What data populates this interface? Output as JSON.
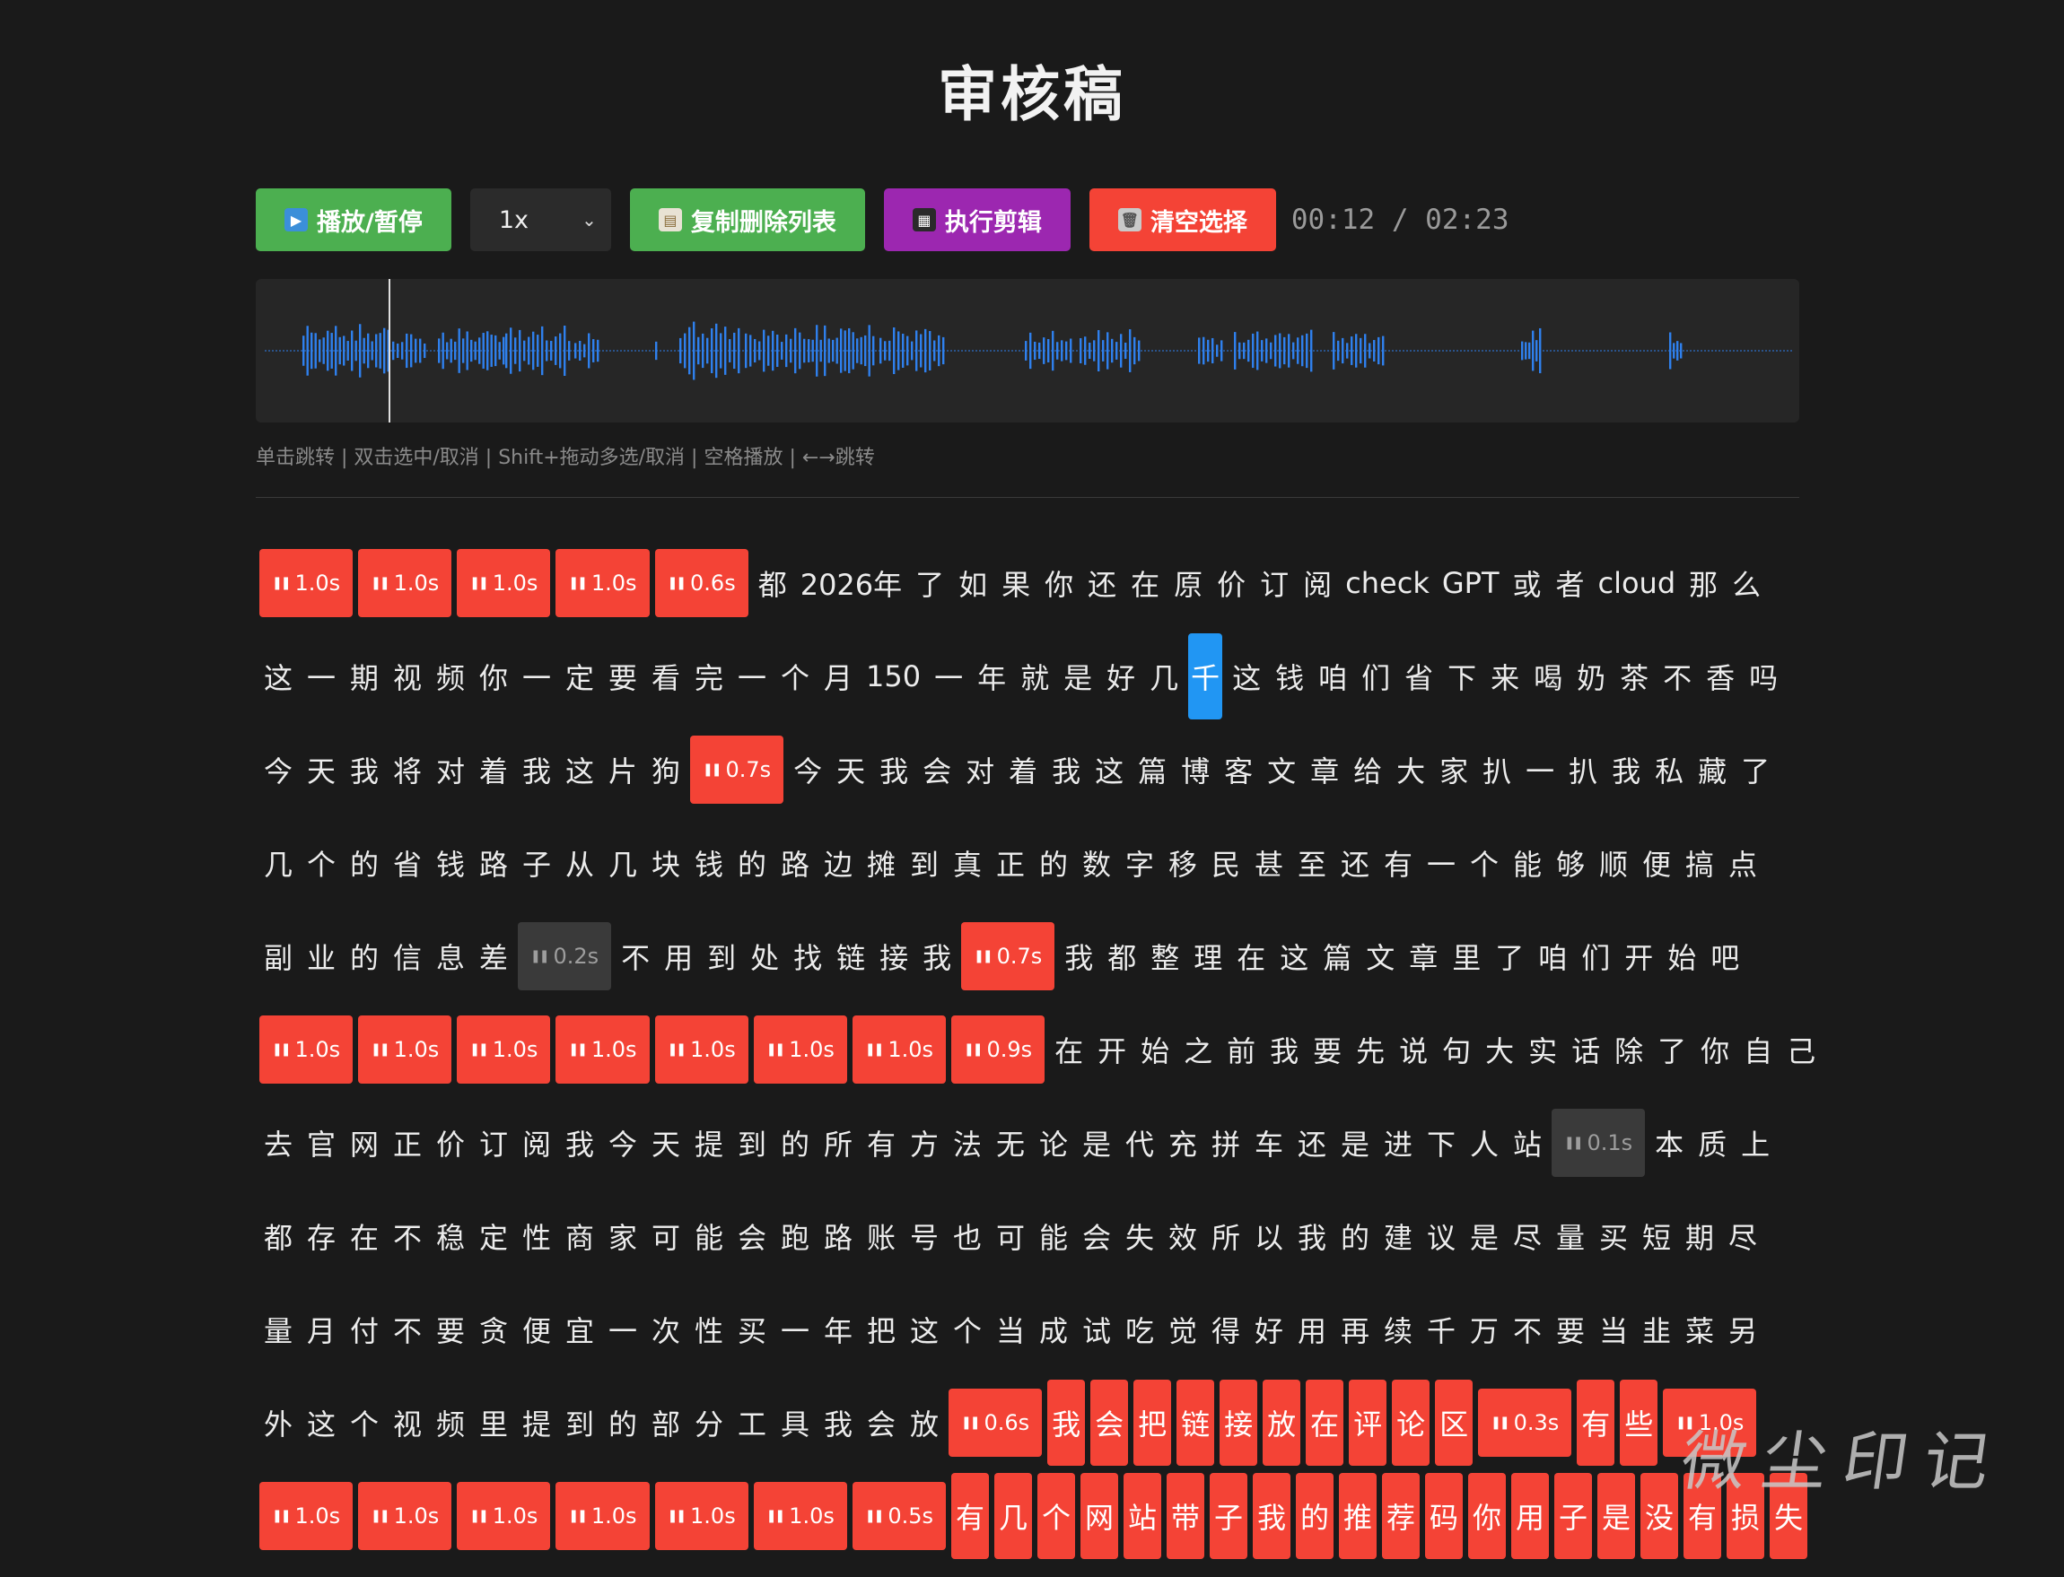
{
  "title": "审核稿",
  "toolbar": {
    "play_label": "播放/暂停",
    "speed_value": "1x",
    "copy_label": "复制删除列表",
    "execute_label": "执行剪辑",
    "clear_label": "清空选择",
    "time": "00:12 / 02:23"
  },
  "hint": "单击跳转 | 双击选中/取消 | Shift+拖动多选/取消 | 空格播放 | ←→跳转",
  "watermark": "微尘印记",
  "colors": {
    "play": "#4caf50",
    "execute": "#9c27b0",
    "delete": "#f44336",
    "selected": "#2196f3",
    "wave": "#2f80ed"
  },
  "playhead_time": "00:12",
  "lines": [
    [
      {
        "t": "pause",
        "d": "1.0s"
      },
      {
        "t": "pause",
        "d": "1.0s"
      },
      {
        "t": "pause",
        "d": "1.0s"
      },
      {
        "t": "pause",
        "d": "1.0s"
      },
      {
        "t": "pause",
        "d": "0.6s"
      },
      {
        "t": "ch",
        "v": "都"
      },
      {
        "t": "ch",
        "v": "2026年"
      },
      {
        "t": "ch",
        "v": "了"
      },
      {
        "t": "ch",
        "v": "如"
      },
      {
        "t": "ch",
        "v": "果"
      },
      {
        "t": "ch",
        "v": "你"
      },
      {
        "t": "ch",
        "v": "还"
      },
      {
        "t": "ch",
        "v": "在"
      },
      {
        "t": "ch",
        "v": "原"
      },
      {
        "t": "ch",
        "v": "价"
      },
      {
        "t": "ch",
        "v": "订"
      },
      {
        "t": "ch",
        "v": "阅"
      },
      {
        "t": "ch",
        "v": "check"
      },
      {
        "t": "ch",
        "v": "GPT"
      },
      {
        "t": "ch",
        "v": "或"
      },
      {
        "t": "ch",
        "v": "者"
      },
      {
        "t": "ch",
        "v": "cloud"
      },
      {
        "t": "ch",
        "v": "那"
      },
      {
        "t": "ch",
        "v": "么"
      }
    ],
    [
      {
        "t": "ch",
        "v": "这"
      },
      {
        "t": "ch",
        "v": "一"
      },
      {
        "t": "ch",
        "v": "期"
      },
      {
        "t": "ch",
        "v": "视"
      },
      {
        "t": "ch",
        "v": "频"
      },
      {
        "t": "ch",
        "v": "你"
      },
      {
        "t": "ch",
        "v": "一"
      },
      {
        "t": "ch",
        "v": "定"
      },
      {
        "t": "ch",
        "v": "要"
      },
      {
        "t": "ch",
        "v": "看"
      },
      {
        "t": "ch",
        "v": "完"
      },
      {
        "t": "ch",
        "v": "一"
      },
      {
        "t": "ch",
        "v": "个"
      },
      {
        "t": "ch",
        "v": "月"
      },
      {
        "t": "ch",
        "v": "150"
      },
      {
        "t": "ch",
        "v": "一"
      },
      {
        "t": "ch",
        "v": "年"
      },
      {
        "t": "ch",
        "v": "就"
      },
      {
        "t": "ch",
        "v": "是"
      },
      {
        "t": "ch",
        "v": "好"
      },
      {
        "t": "ch",
        "v": "几"
      },
      {
        "t": "sel",
        "v": "千"
      },
      {
        "t": "ch",
        "v": "这"
      },
      {
        "t": "ch",
        "v": "钱"
      },
      {
        "t": "ch",
        "v": "咱"
      },
      {
        "t": "ch",
        "v": "们"
      },
      {
        "t": "ch",
        "v": "省"
      },
      {
        "t": "ch",
        "v": "下"
      },
      {
        "t": "ch",
        "v": "来"
      },
      {
        "t": "ch",
        "v": "喝"
      },
      {
        "t": "ch",
        "v": "奶"
      },
      {
        "t": "ch",
        "v": "茶"
      },
      {
        "t": "ch",
        "v": "不"
      },
      {
        "t": "ch",
        "v": "香"
      },
      {
        "t": "ch",
        "v": "吗"
      }
    ],
    [
      {
        "t": "ch",
        "v": "今"
      },
      {
        "t": "ch",
        "v": "天"
      },
      {
        "t": "ch",
        "v": "我"
      },
      {
        "t": "ch",
        "v": "将"
      },
      {
        "t": "ch",
        "v": "对"
      },
      {
        "t": "ch",
        "v": "着"
      },
      {
        "t": "ch",
        "v": "我"
      },
      {
        "t": "ch",
        "v": "这"
      },
      {
        "t": "ch",
        "v": "片"
      },
      {
        "t": "ch",
        "v": "狗"
      },
      {
        "t": "pause",
        "d": "0.7s"
      },
      {
        "t": "ch",
        "v": "今"
      },
      {
        "t": "ch",
        "v": "天"
      },
      {
        "t": "ch",
        "v": "我"
      },
      {
        "t": "ch",
        "v": "会"
      },
      {
        "t": "ch",
        "v": "对"
      },
      {
        "t": "ch",
        "v": "着"
      },
      {
        "t": "ch",
        "v": "我"
      },
      {
        "t": "ch",
        "v": "这"
      },
      {
        "t": "ch",
        "v": "篇"
      },
      {
        "t": "ch",
        "v": "博"
      },
      {
        "t": "ch",
        "v": "客"
      },
      {
        "t": "ch",
        "v": "文"
      },
      {
        "t": "ch",
        "v": "章"
      },
      {
        "t": "ch",
        "v": "给"
      },
      {
        "t": "ch",
        "v": "大"
      },
      {
        "t": "ch",
        "v": "家"
      },
      {
        "t": "ch",
        "v": "扒"
      },
      {
        "t": "ch",
        "v": "一"
      },
      {
        "t": "ch",
        "v": "扒"
      },
      {
        "t": "ch",
        "v": "我"
      },
      {
        "t": "ch",
        "v": "私"
      },
      {
        "t": "ch",
        "v": "藏"
      },
      {
        "t": "ch",
        "v": "了"
      }
    ],
    [
      {
        "t": "ch",
        "v": "几"
      },
      {
        "t": "ch",
        "v": "个"
      },
      {
        "t": "ch",
        "v": "的"
      },
      {
        "t": "ch",
        "v": "省"
      },
      {
        "t": "ch",
        "v": "钱"
      },
      {
        "t": "ch",
        "v": "路"
      },
      {
        "t": "ch",
        "v": "子"
      },
      {
        "t": "ch",
        "v": "从"
      },
      {
        "t": "ch",
        "v": "几"
      },
      {
        "t": "ch",
        "v": "块"
      },
      {
        "t": "ch",
        "v": "钱"
      },
      {
        "t": "ch",
        "v": "的"
      },
      {
        "t": "ch",
        "v": "路"
      },
      {
        "t": "ch",
        "v": "边"
      },
      {
        "t": "ch",
        "v": "摊"
      },
      {
        "t": "ch",
        "v": "到"
      },
      {
        "t": "ch",
        "v": "真"
      },
      {
        "t": "ch",
        "v": "正"
      },
      {
        "t": "ch",
        "v": "的"
      },
      {
        "t": "ch",
        "v": "数"
      },
      {
        "t": "ch",
        "v": "字"
      },
      {
        "t": "ch",
        "v": "移"
      },
      {
        "t": "ch",
        "v": "民"
      },
      {
        "t": "ch",
        "v": "甚"
      },
      {
        "t": "ch",
        "v": "至"
      },
      {
        "t": "ch",
        "v": "还"
      },
      {
        "t": "ch",
        "v": "有"
      },
      {
        "t": "ch",
        "v": "一"
      },
      {
        "t": "ch",
        "v": "个"
      },
      {
        "t": "ch",
        "v": "能"
      },
      {
        "t": "ch",
        "v": "够"
      },
      {
        "t": "ch",
        "v": "顺"
      },
      {
        "t": "ch",
        "v": "便"
      },
      {
        "t": "ch",
        "v": "搞"
      },
      {
        "t": "ch",
        "v": "点"
      }
    ],
    [
      {
        "t": "ch",
        "v": "副"
      },
      {
        "t": "ch",
        "v": "业"
      },
      {
        "t": "ch",
        "v": "的"
      },
      {
        "t": "ch",
        "v": "信"
      },
      {
        "t": "ch",
        "v": "息"
      },
      {
        "t": "ch",
        "v": "差"
      },
      {
        "t": "gpause",
        "d": "0.2s"
      },
      {
        "t": "ch",
        "v": "不"
      },
      {
        "t": "ch",
        "v": "用"
      },
      {
        "t": "ch",
        "v": "到"
      },
      {
        "t": "ch",
        "v": "处"
      },
      {
        "t": "ch",
        "v": "找"
      },
      {
        "t": "ch",
        "v": "链"
      },
      {
        "t": "ch",
        "v": "接"
      },
      {
        "t": "ch",
        "v": "我"
      },
      {
        "t": "pause",
        "d": "0.7s"
      },
      {
        "t": "ch",
        "v": "我"
      },
      {
        "t": "ch",
        "v": "都"
      },
      {
        "t": "ch",
        "v": "整"
      },
      {
        "t": "ch",
        "v": "理"
      },
      {
        "t": "ch",
        "v": "在"
      },
      {
        "t": "ch",
        "v": "这"
      },
      {
        "t": "ch",
        "v": "篇"
      },
      {
        "t": "ch",
        "v": "文"
      },
      {
        "t": "ch",
        "v": "章"
      },
      {
        "t": "ch",
        "v": "里"
      },
      {
        "t": "ch",
        "v": "了"
      },
      {
        "t": "ch",
        "v": "咱"
      },
      {
        "t": "ch",
        "v": "们"
      },
      {
        "t": "ch",
        "v": "开"
      },
      {
        "t": "ch",
        "v": "始"
      },
      {
        "t": "ch",
        "v": "吧"
      }
    ],
    [
      {
        "t": "pause",
        "d": "1.0s"
      },
      {
        "t": "pause",
        "d": "1.0s"
      },
      {
        "t": "pause",
        "d": "1.0s"
      },
      {
        "t": "pause",
        "d": "1.0s"
      },
      {
        "t": "pause",
        "d": "1.0s"
      },
      {
        "t": "pause",
        "d": "1.0s"
      },
      {
        "t": "pause",
        "d": "1.0s"
      },
      {
        "t": "pause",
        "d": "0.9s"
      },
      {
        "t": "ch",
        "v": "在"
      },
      {
        "t": "ch",
        "v": "开"
      },
      {
        "t": "ch",
        "v": "始"
      },
      {
        "t": "ch",
        "v": "之"
      },
      {
        "t": "ch",
        "v": "前"
      },
      {
        "t": "ch",
        "v": "我"
      },
      {
        "t": "ch",
        "v": "要"
      },
      {
        "t": "ch",
        "v": "先"
      },
      {
        "t": "ch",
        "v": "说"
      },
      {
        "t": "ch",
        "v": "句"
      },
      {
        "t": "ch",
        "v": "大"
      },
      {
        "t": "ch",
        "v": "实"
      },
      {
        "t": "ch",
        "v": "话"
      },
      {
        "t": "ch",
        "v": "除"
      },
      {
        "t": "ch",
        "v": "了"
      },
      {
        "t": "ch",
        "v": "你"
      },
      {
        "t": "ch",
        "v": "自"
      },
      {
        "t": "ch",
        "v": "己"
      }
    ],
    [
      {
        "t": "ch",
        "v": "去"
      },
      {
        "t": "ch",
        "v": "官"
      },
      {
        "t": "ch",
        "v": "网"
      },
      {
        "t": "ch",
        "v": "正"
      },
      {
        "t": "ch",
        "v": "价"
      },
      {
        "t": "ch",
        "v": "订"
      },
      {
        "t": "ch",
        "v": "阅"
      },
      {
        "t": "ch",
        "v": "我"
      },
      {
        "t": "ch",
        "v": "今"
      },
      {
        "t": "ch",
        "v": "天"
      },
      {
        "t": "ch",
        "v": "提"
      },
      {
        "t": "ch",
        "v": "到"
      },
      {
        "t": "ch",
        "v": "的"
      },
      {
        "t": "ch",
        "v": "所"
      },
      {
        "t": "ch",
        "v": "有"
      },
      {
        "t": "ch",
        "v": "方"
      },
      {
        "t": "ch",
        "v": "法"
      },
      {
        "t": "ch",
        "v": "无"
      },
      {
        "t": "ch",
        "v": "论"
      },
      {
        "t": "ch",
        "v": "是"
      },
      {
        "t": "ch",
        "v": "代"
      },
      {
        "t": "ch",
        "v": "充"
      },
      {
        "t": "ch",
        "v": "拼"
      },
      {
        "t": "ch",
        "v": "车"
      },
      {
        "t": "ch",
        "v": "还"
      },
      {
        "t": "ch",
        "v": "是"
      },
      {
        "t": "ch",
        "v": "进"
      },
      {
        "t": "ch",
        "v": "下"
      },
      {
        "t": "ch",
        "v": "人"
      },
      {
        "t": "ch",
        "v": "站"
      },
      {
        "t": "gpause",
        "d": "0.1s"
      },
      {
        "t": "ch",
        "v": "本"
      },
      {
        "t": "ch",
        "v": "质"
      },
      {
        "t": "ch",
        "v": "上"
      }
    ],
    [
      {
        "t": "ch",
        "v": "都"
      },
      {
        "t": "ch",
        "v": "存"
      },
      {
        "t": "ch",
        "v": "在"
      },
      {
        "t": "ch",
        "v": "不"
      },
      {
        "t": "ch",
        "v": "稳"
      },
      {
        "t": "ch",
        "v": "定"
      },
      {
        "t": "ch",
        "v": "性"
      },
      {
        "t": "ch",
        "v": "商"
      },
      {
        "t": "ch",
        "v": "家"
      },
      {
        "t": "ch",
        "v": "可"
      },
      {
        "t": "ch",
        "v": "能"
      },
      {
        "t": "ch",
        "v": "会"
      },
      {
        "t": "ch",
        "v": "跑"
      },
      {
        "t": "ch",
        "v": "路"
      },
      {
        "t": "ch",
        "v": "账"
      },
      {
        "t": "ch",
        "v": "号"
      },
      {
        "t": "ch",
        "v": "也"
      },
      {
        "t": "ch",
        "v": "可"
      },
      {
        "t": "ch",
        "v": "能"
      },
      {
        "t": "ch",
        "v": "会"
      },
      {
        "t": "ch",
        "v": "失"
      },
      {
        "t": "ch",
        "v": "效"
      },
      {
        "t": "ch",
        "v": "所"
      },
      {
        "t": "ch",
        "v": "以"
      },
      {
        "t": "ch",
        "v": "我"
      },
      {
        "t": "ch",
        "v": "的"
      },
      {
        "t": "ch",
        "v": "建"
      },
      {
        "t": "ch",
        "v": "议"
      },
      {
        "t": "ch",
        "v": "是"
      },
      {
        "t": "ch",
        "v": "尽"
      },
      {
        "t": "ch",
        "v": "量"
      },
      {
        "t": "ch",
        "v": "买"
      },
      {
        "t": "ch",
        "v": "短"
      },
      {
        "t": "ch",
        "v": "期"
      },
      {
        "t": "ch",
        "v": "尽"
      }
    ],
    [
      {
        "t": "ch",
        "v": "量"
      },
      {
        "t": "ch",
        "v": "月"
      },
      {
        "t": "ch",
        "v": "付"
      },
      {
        "t": "ch",
        "v": "不"
      },
      {
        "t": "ch",
        "v": "要"
      },
      {
        "t": "ch",
        "v": "贪"
      },
      {
        "t": "ch",
        "v": "便"
      },
      {
        "t": "ch",
        "v": "宜"
      },
      {
        "t": "ch",
        "v": "一"
      },
      {
        "t": "ch",
        "v": "次"
      },
      {
        "t": "ch",
        "v": "性"
      },
      {
        "t": "ch",
        "v": "买"
      },
      {
        "t": "ch",
        "v": "一"
      },
      {
        "t": "ch",
        "v": "年"
      },
      {
        "t": "ch",
        "v": "把"
      },
      {
        "t": "ch",
        "v": "这"
      },
      {
        "t": "ch",
        "v": "个"
      },
      {
        "t": "ch",
        "v": "当"
      },
      {
        "t": "ch",
        "v": "成"
      },
      {
        "t": "ch",
        "v": "试"
      },
      {
        "t": "ch",
        "v": "吃"
      },
      {
        "t": "ch",
        "v": "觉"
      },
      {
        "t": "ch",
        "v": "得"
      },
      {
        "t": "ch",
        "v": "好"
      },
      {
        "t": "ch",
        "v": "用"
      },
      {
        "t": "ch",
        "v": "再"
      },
      {
        "t": "ch",
        "v": "续"
      },
      {
        "t": "ch",
        "v": "千"
      },
      {
        "t": "ch",
        "v": "万"
      },
      {
        "t": "ch",
        "v": "不"
      },
      {
        "t": "ch",
        "v": "要"
      },
      {
        "t": "ch",
        "v": "当"
      },
      {
        "t": "ch",
        "v": "韭"
      },
      {
        "t": "ch",
        "v": "菜"
      },
      {
        "t": "ch",
        "v": "另"
      }
    ],
    [
      {
        "t": "ch",
        "v": "外"
      },
      {
        "t": "ch",
        "v": "这"
      },
      {
        "t": "ch",
        "v": "个"
      },
      {
        "t": "ch",
        "v": "视"
      },
      {
        "t": "ch",
        "v": "频"
      },
      {
        "t": "ch",
        "v": "里"
      },
      {
        "t": "ch",
        "v": "提"
      },
      {
        "t": "ch",
        "v": "到"
      },
      {
        "t": "ch",
        "v": "的"
      },
      {
        "t": "ch",
        "v": "部"
      },
      {
        "t": "ch",
        "v": "分"
      },
      {
        "t": "ch",
        "v": "工"
      },
      {
        "t": "ch",
        "v": "具"
      },
      {
        "t": "ch",
        "v": "我"
      },
      {
        "t": "ch",
        "v": "会"
      },
      {
        "t": "ch",
        "v": "放"
      },
      {
        "t": "pause",
        "d": "0.6s"
      },
      {
        "t": "del",
        "v": "我"
      },
      {
        "t": "del",
        "v": "会"
      },
      {
        "t": "del",
        "v": "把"
      },
      {
        "t": "del",
        "v": "链"
      },
      {
        "t": "del",
        "v": "接"
      },
      {
        "t": "del",
        "v": "放"
      },
      {
        "t": "del",
        "v": "在"
      },
      {
        "t": "del",
        "v": "评"
      },
      {
        "t": "del",
        "v": "论"
      },
      {
        "t": "del",
        "v": "区"
      },
      {
        "t": "pause",
        "d": "0.3s"
      },
      {
        "t": "del",
        "v": "有"
      },
      {
        "t": "del",
        "v": "些"
      },
      {
        "t": "pause",
        "d": "1.0s"
      }
    ],
    [
      {
        "t": "pause",
        "d": "1.0s"
      },
      {
        "t": "pause",
        "d": "1.0s"
      },
      {
        "t": "pause",
        "d": "1.0s"
      },
      {
        "t": "pause",
        "d": "1.0s"
      },
      {
        "t": "pause",
        "d": "1.0s"
      },
      {
        "t": "pause",
        "d": "1.0s"
      },
      {
        "t": "pause",
        "d": "0.5s"
      },
      {
        "t": "del",
        "v": "有"
      },
      {
        "t": "del",
        "v": "几"
      },
      {
        "t": "del",
        "v": "个"
      },
      {
        "t": "del",
        "v": "网"
      },
      {
        "t": "del",
        "v": "站"
      },
      {
        "t": "del",
        "v": "带"
      },
      {
        "t": "del",
        "v": "子"
      },
      {
        "t": "del",
        "v": "我"
      },
      {
        "t": "del",
        "v": "的"
      },
      {
        "t": "del",
        "v": "推"
      },
      {
        "t": "del",
        "v": "荐"
      },
      {
        "t": "del",
        "v": "码"
      },
      {
        "t": "del",
        "v": "你"
      },
      {
        "t": "del",
        "v": "用"
      },
      {
        "t": "del",
        "v": "子"
      },
      {
        "t": "del",
        "v": "是"
      },
      {
        "t": "del",
        "v": "没"
      },
      {
        "t": "del",
        "v": "有"
      },
      {
        "t": "del",
        "v": "损"
      },
      {
        "t": "del",
        "v": "失"
      }
    ]
  ]
}
